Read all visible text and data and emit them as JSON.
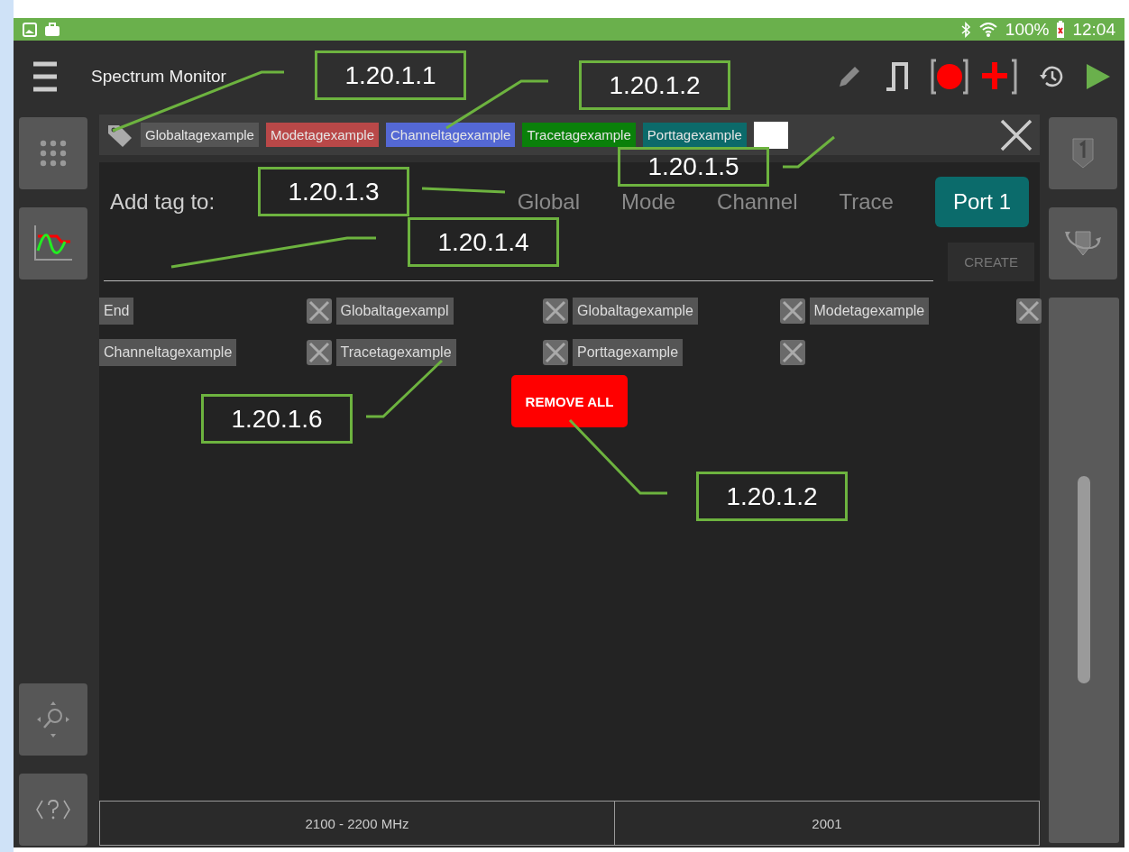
{
  "status_bar": {
    "battery": "100%",
    "time": "12:04"
  },
  "app_bar": {
    "title": "Spectrum Monitor"
  },
  "tag_bar": {
    "tags": [
      {
        "label": "Globaltagexample",
        "color": "#555555"
      },
      {
        "label": "Modetagexample",
        "color": "#b94848"
      },
      {
        "label": "Channeltagexample",
        "color": "#5468d4"
      },
      {
        "label": "Tracetagexample",
        "color": "#0a800a"
      },
      {
        "label": "Porttagexample",
        "color": "#0c6a6a"
      }
    ]
  },
  "add_tag": {
    "label": "Add tag to:",
    "targets": [
      {
        "label": "Global",
        "selected": false
      },
      {
        "label": "Mode",
        "selected": false
      },
      {
        "label": "Channel",
        "selected": false
      },
      {
        "label": "Trace",
        "selected": false
      },
      {
        "label": "Port 1",
        "selected": true
      }
    ],
    "create_button": {
      "label": "CREATE",
      "disabled": true
    }
  },
  "tag_list": [
    {
      "label": "End"
    },
    {
      "label": "Globaltagexampl"
    },
    {
      "label": "Globaltagexample"
    },
    {
      "label": "Modetagexample"
    },
    {
      "label": "Channeltagexample"
    },
    {
      "label": "Tracetagexample"
    },
    {
      "label": "Porttagexample"
    }
  ],
  "remove_all": {
    "label": "REMOVE ALL"
  },
  "footer": {
    "cells": [
      "2100 - 2200 MHz",
      "2001"
    ]
  },
  "callouts": [
    {
      "label": "1.20.1.1"
    },
    {
      "label": "1.20.1.2"
    },
    {
      "label": "1.20.1.3"
    },
    {
      "label": "1.20.1.4"
    },
    {
      "label": "1.20.1.5"
    },
    {
      "label": "1.20.1.6"
    },
    {
      "label": "1.20.1.2"
    }
  ]
}
